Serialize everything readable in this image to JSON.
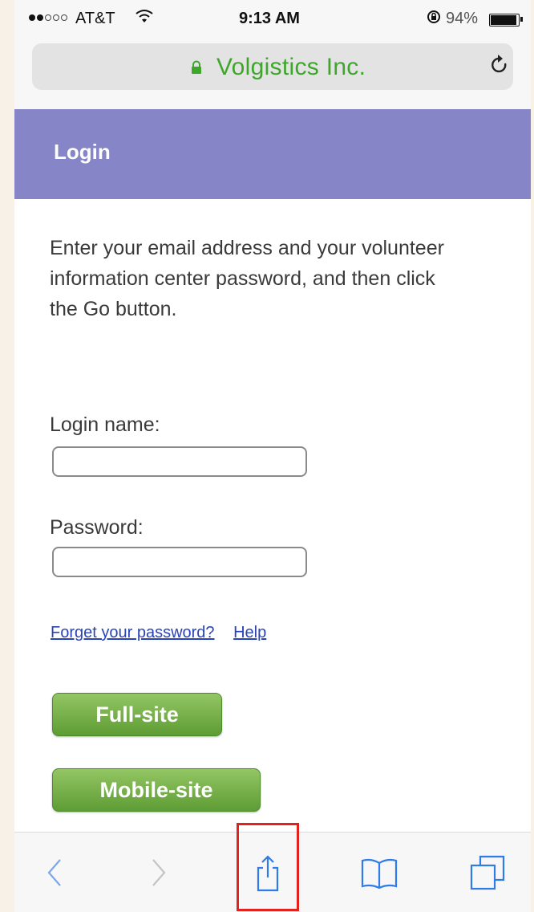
{
  "status_bar": {
    "carrier": "AT&T",
    "time": "9:13 AM",
    "battery_percent": "94%",
    "battery_level": 0.94,
    "signal_bars_filled": 2,
    "signal_bars_total": 5
  },
  "url_bar": {
    "host": "Volgistics Inc.",
    "host_color": "#3ea62b",
    "lock_icon": "lock-icon",
    "reload_icon": "reload-icon"
  },
  "header": {
    "title": "Login",
    "background": "#8585c7"
  },
  "main": {
    "instructions": "Enter your email address and your volunteer information center password, and then click the Go button.",
    "login_label": "Login name:",
    "login_value": "",
    "password_label": "Password:",
    "password_value": "",
    "forgot_link": "Forget your password?",
    "help_link": "Help",
    "full_site_button": "Full-site",
    "mobile_site_button": "Mobile-site"
  },
  "toolbar": {
    "items": [
      "back-icon",
      "forward-icon",
      "share-icon",
      "bookmarks-icon",
      "tabs-icon"
    ],
    "highlighted": "share-icon",
    "highlight_color": "#e0231f"
  }
}
